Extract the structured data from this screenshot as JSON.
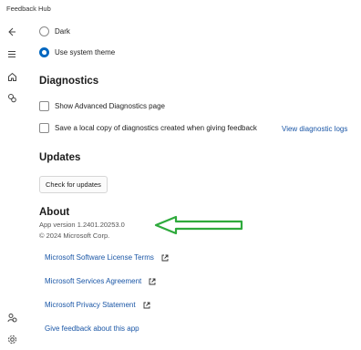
{
  "app": {
    "title": "Feedback Hub"
  },
  "theme": {
    "options": [
      {
        "label": "Dark",
        "selected": false
      },
      {
        "label": "Use system theme",
        "selected": true
      }
    ]
  },
  "diagnostics": {
    "title": "Diagnostics",
    "show_advanced_label": "Show Advanced Diagnostics page",
    "save_local_copy_label": "Save a local copy of diagnostics created when giving feedback",
    "view_logs_link": "View diagnostic logs"
  },
  "updates": {
    "title": "Updates",
    "check_button": "Check for updates"
  },
  "about": {
    "title": "About",
    "version": "App version 1.2401.20253.0",
    "copyright": "© 2024 Microsoft Corp.",
    "links": [
      "Microsoft Software License Terms",
      "Microsoft Services Agreement",
      "Microsoft Privacy Statement",
      "Give feedback about this app"
    ]
  },
  "colors": {
    "accent": "#0067c0",
    "link": "#1a56a6",
    "annotation_arrow": "#2eaa3c"
  },
  "icons": {
    "nav": [
      "back-icon",
      "menu-icon",
      "home-icon",
      "feedback-icon",
      "achievements-icon",
      "settings-icon"
    ],
    "link": "open-external-icon"
  }
}
